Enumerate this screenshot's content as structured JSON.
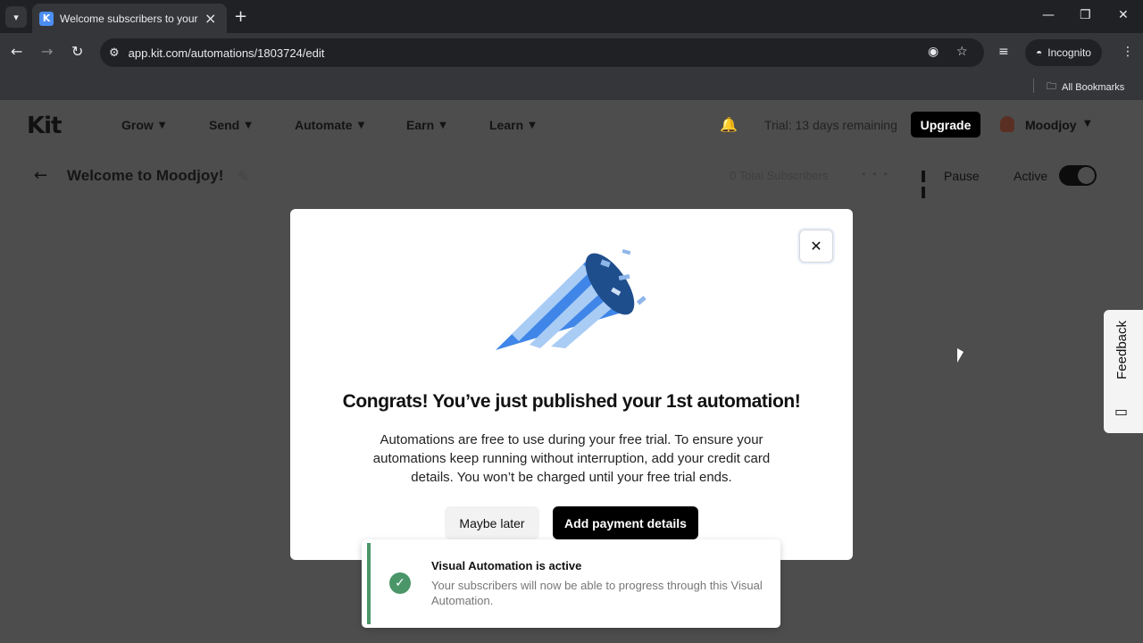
{
  "browser": {
    "tab_title": "Welcome subscribers to your p",
    "tab_favicon": "K",
    "url": "app.kit.com/automations/1803724/edit",
    "incognito_label": "Incognito",
    "all_bookmarks": "All Bookmarks"
  },
  "header": {
    "logo": "Kit",
    "menu": [
      "Grow",
      "Send",
      "Automate",
      "Earn",
      "Learn"
    ],
    "trial": "Trial: 13 days remaining",
    "upgrade": "Upgrade",
    "user": "Moodjoy"
  },
  "subbar": {
    "title": "Welcome to Moodjoy!",
    "subscribers": "0 Total Subscribers",
    "more": "• • •",
    "pause": "Pause",
    "active": "Active"
  },
  "feedback": {
    "label": "Feedback"
  },
  "modal": {
    "title": "Congrats! You’ve just published your 1st automation!",
    "body": "Automations are free to use during your free trial. To ensure your automations keep running without interruption, add your credit card details. You won’t be charged until your free trial ends.",
    "secondary_button": "Maybe later",
    "primary_button": "Add payment details"
  },
  "toast": {
    "title": "Visual Automation is active",
    "message": "Your subscribers will now be able to progress through this Visual Automation."
  },
  "colors": {
    "accent": "#000000",
    "success": "#4a9669",
    "party_blue": "#3f86e8"
  }
}
